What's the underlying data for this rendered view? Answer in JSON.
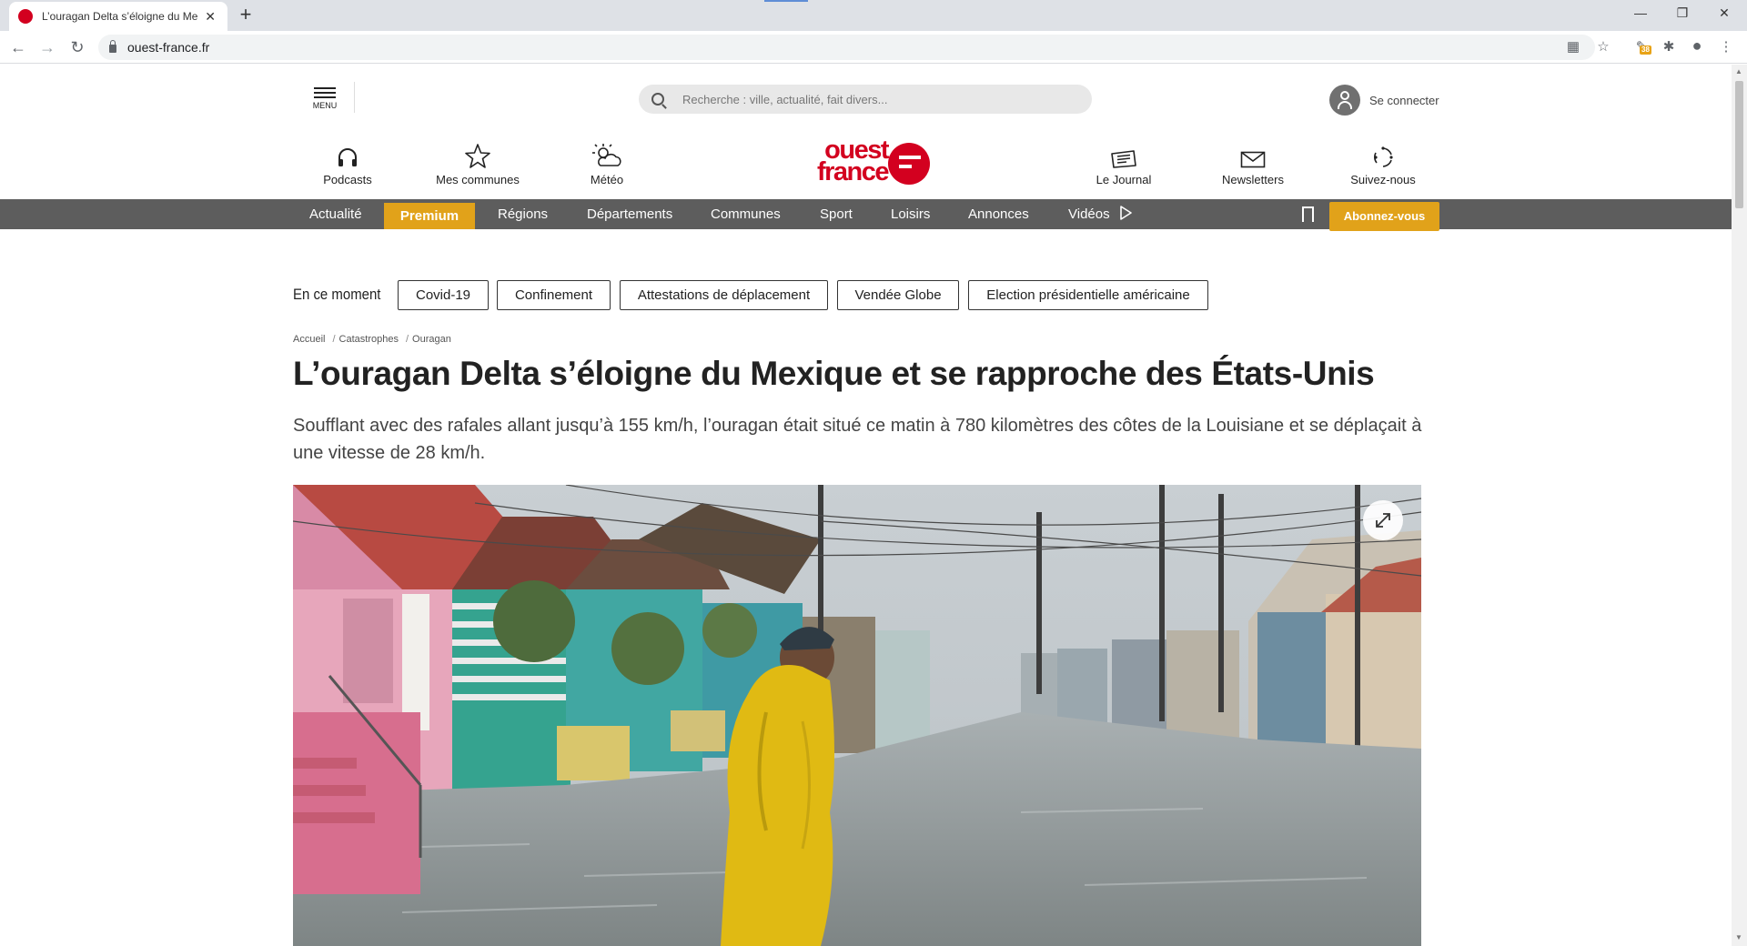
{
  "browser": {
    "tab_title": "L’ouragan Delta s’éloigne du Me",
    "url": "ouest-france.fr",
    "extension_badge": "38",
    "window_controls": [
      "minimize-icon",
      "restore-icon",
      "close-icon"
    ]
  },
  "header": {
    "menu_label": "MENU",
    "search_placeholder": "Recherche : ville, actualité, fait divers...",
    "login_label": "Se connecter",
    "logo_text": "ouest france",
    "top_nav": [
      {
        "label": "Podcasts",
        "icon": "headphones-icon"
      },
      {
        "label": "Mes communes",
        "icon": "star-icon"
      },
      {
        "label": "Météo",
        "icon": "weather-icon"
      },
      {
        "label": "Le Journal",
        "icon": "newspaper-icon"
      },
      {
        "label": "Newsletters",
        "icon": "envelope-icon"
      },
      {
        "label": "Suivez-nous",
        "icon": "share-icon"
      }
    ]
  },
  "main_nav": {
    "items": [
      "Actualité",
      "Premium",
      "Régions",
      "Départements",
      "Communes",
      "Sport",
      "Loisirs",
      "Annonces",
      "Vidéos"
    ],
    "subscribe_label": "Abonnez-vous"
  },
  "trending": {
    "label": "En ce moment",
    "tags": [
      "Covid-19",
      "Confinement",
      "Attestations de déplacement",
      "Vendée Globe",
      "Election présidentielle américaine"
    ]
  },
  "article": {
    "breadcrumb": [
      "Accueil",
      "Catastrophes",
      "Ouragan"
    ],
    "title": "L’ouragan Delta s’éloigne du Mexique et se rapproche des États-Unis",
    "lead": "Soufflant avec des rafales allant jusqu’à 155 km/h, l’ouragan était situé ce matin à 780 kilomètres des côtes de la Louisiane et se déplaçait à une vitesse de 28 km/h."
  },
  "colors": {
    "brand_red": "#d3001f",
    "premium_gold": "#e1a21a",
    "nav_gray": "#5d5d5d"
  }
}
